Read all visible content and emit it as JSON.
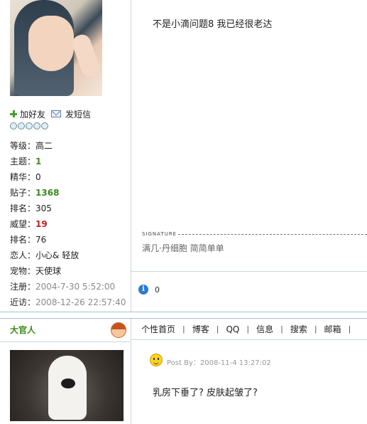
{
  "post1": {
    "actions": {
      "add_friend": "加好友",
      "send_msg": "发短信"
    },
    "stats": [
      {
        "label": "等级：",
        "value": "高二",
        "style": "plain"
      },
      {
        "label": "主题：",
        "value": "1",
        "style": "green"
      },
      {
        "label": "精华：",
        "value": "0",
        "style": "plain"
      },
      {
        "label": "贴子：",
        "value": "1368",
        "style": "green"
      },
      {
        "label": "排名：",
        "value": "305",
        "style": "plain"
      },
      {
        "label": "威望：",
        "value": "19",
        "style": "red"
      },
      {
        "label": "排名：",
        "value": "76",
        "style": "plain"
      },
      {
        "label": "恋人：",
        "value": "小心& 轻放",
        "style": "plain"
      },
      {
        "label": "宠物：",
        "value": "天使球",
        "style": "plain"
      },
      {
        "label": "注册：",
        "value": "2004-7-30 5:52:00",
        "style": "gray"
      },
      {
        "label": "近访：",
        "value": "2008-12-26 22:57:40",
        "style": "gray"
      }
    ],
    "message": "不是小滴问题8  我已经很老达",
    "signature_label": "SIGNATURE",
    "signature_text": "满几·丹细胞  简简单单",
    "info_count": "0"
  },
  "post2": {
    "username": "大官人",
    "nav": [
      "个性首页",
      "博客",
      "QQ",
      "信息",
      "搜索",
      "邮箱"
    ],
    "post_by": "Post By：2008-11-4 13:27:02",
    "message": "乳房下垂了? 皮肤起皱了?"
  },
  "colors": {
    "green": "#3a8a1f",
    "red": "#c41e1e",
    "border": "#c9d7e3"
  }
}
